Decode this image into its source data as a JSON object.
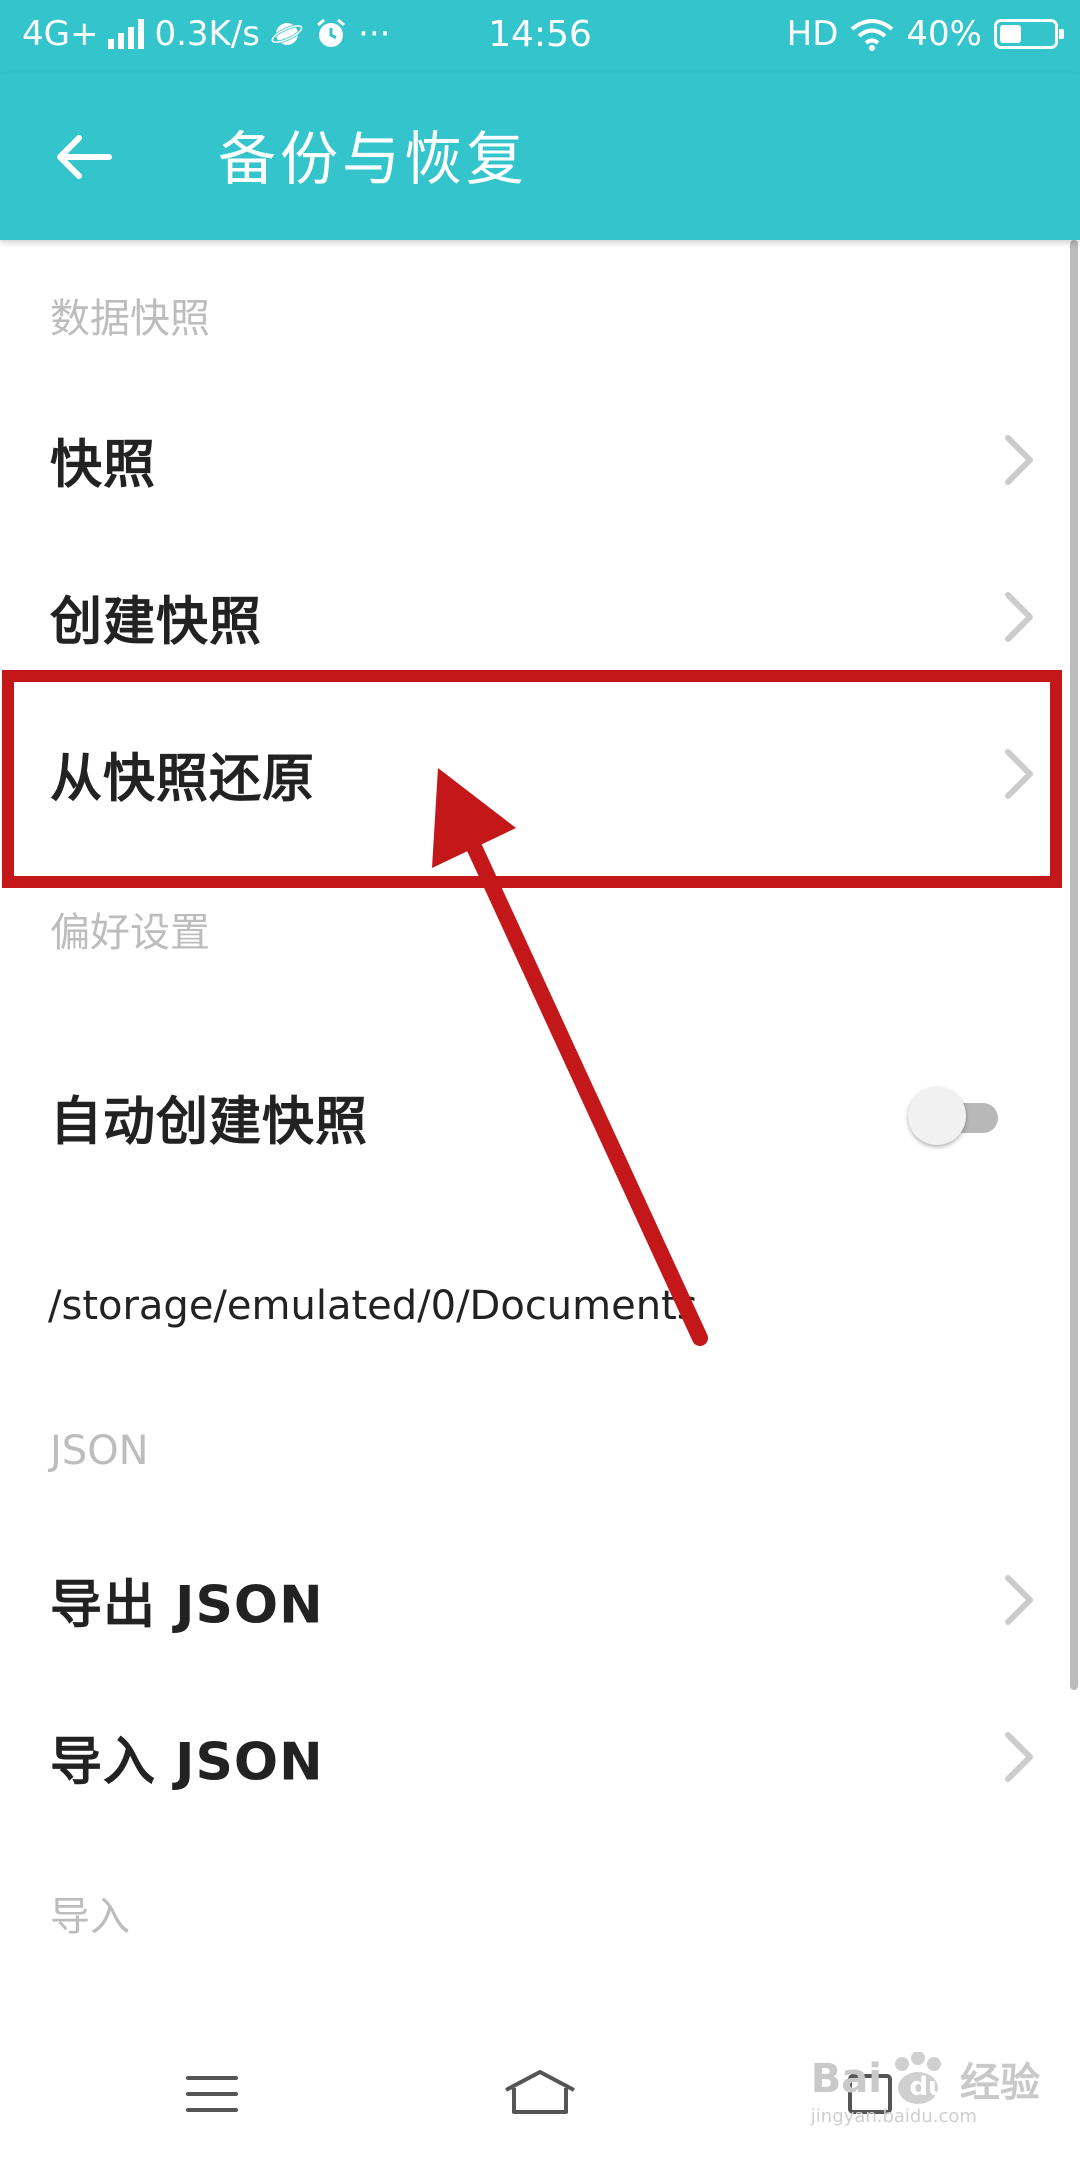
{
  "status_bar": {
    "network": "4G+",
    "speed": "0.3K/s",
    "more": "···",
    "time": "14:56",
    "hd": "HD",
    "battery_text": "40%",
    "battery_level": 0.4
  },
  "app_bar": {
    "title": "备份与恢复"
  },
  "sections": {
    "snapshot_header": "数据快照",
    "preferences_header": "偏好设置",
    "json_header": "JSON",
    "import_header": "导入"
  },
  "items": {
    "snapshots": "快照",
    "create_snapshot": "创建快照",
    "restore_snapshot": "从快照还原",
    "auto_snapshot": "自动创建快照",
    "storage_path": "/storage/emulated/0/Documents",
    "export_json": "导出 JSON",
    "import_json": "导入 JSON"
  },
  "toggle": {
    "auto_snapshot_on": false
  },
  "watermark": {
    "brand": "Bai",
    "du": "du",
    "jingyan": "经验",
    "url": "jingyan.baidu.com"
  },
  "colors": {
    "primary": "#33c4cc",
    "annotation": "#c4171a",
    "section_header": "#bdbdbd",
    "label": "#222222"
  },
  "icons": {
    "back": "arrow-left-icon",
    "chevron": "chevron-right-icon",
    "menu": "menu-icon",
    "home": "home-icon",
    "recent": "recent-apps-icon"
  }
}
